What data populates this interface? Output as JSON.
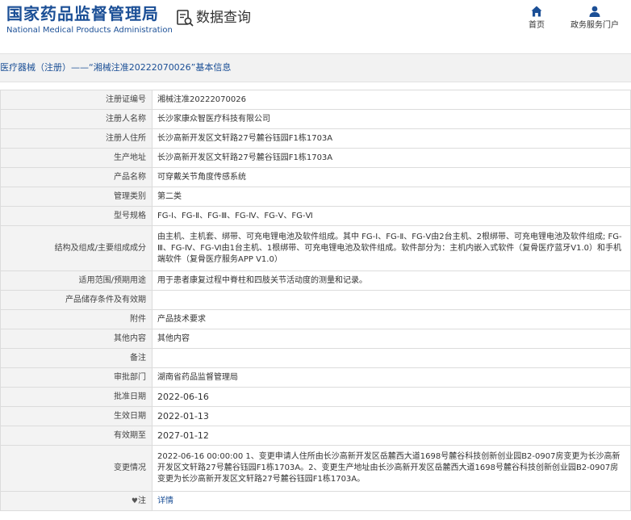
{
  "header": {
    "logo_cn": "国家药品监督管理局",
    "logo_en": "National Medical Products Administration",
    "query_label": "数据查询",
    "nav": [
      {
        "label": "首页",
        "icon": "home-icon"
      },
      {
        "label": "政务服务门户",
        "icon": "user-icon"
      }
    ]
  },
  "breadcrumb": "医疗器械（注册）——“湘械注准20222070026”基本信息",
  "colors": {
    "brand": "#1b4f96",
    "label_bg": "#f3f3f3",
    "bar_bg": "#f2f2f2"
  },
  "rows": [
    {
      "label": "注册证编号",
      "value": "湘械注准20222070026"
    },
    {
      "label": "注册人名称",
      "value": "长沙家康众智医疗科技有限公司"
    },
    {
      "label": "注册人住所",
      "value": "长沙高新开发区文轩路27号麓谷钰园F1栋1703A"
    },
    {
      "label": "生产地址",
      "value": "长沙高新开发区文轩路27号麓谷钰园F1栋1703A"
    },
    {
      "label": "产品名称",
      "value": "可穿戴关节角度传感系统"
    },
    {
      "label": "管理类别",
      "value": "第二类"
    },
    {
      "label": "型号规格",
      "value": "FG-Ⅰ、FG-Ⅱ、FG-Ⅲ、FG-Ⅳ、FG-Ⅴ、FG-Ⅵ"
    },
    {
      "label": "结构及组成/主要组成成分",
      "value": "由主机、主机套、绑带、可充电锂电池及软件组成。其中 FG-Ⅰ、FG-Ⅱ、FG-Ⅴ由2台主机、2根绑带、可充电锂电池及软件组成; FG-Ⅲ、FG-Ⅳ、FG-Ⅵ由1台主机、1根绑带、可充电锂电池及软件组成。软件部分为：主机内嵌入式软件（复骨医疗蓝牙V1.0）和手机端软件（复骨医疗服务APP V1.0）"
    },
    {
      "label": "适用范围/预期用途",
      "value": "用于患者康复过程中脊柱和四肢关节活动度的测量和记录。"
    },
    {
      "label": "产品储存条件及有效期",
      "value": ""
    },
    {
      "label": "附件",
      "value": "产品技术要求"
    },
    {
      "label": "其他内容",
      "value": "其他内容"
    },
    {
      "label": "备注",
      "value": ""
    },
    {
      "label": "审批部门",
      "value": "湖南省药品监督管理局"
    },
    {
      "label": "批准日期",
      "value": "2022-06-16"
    },
    {
      "label": "生效日期",
      "value": "2022-01-13"
    },
    {
      "label": "有效期至",
      "value": "2027-01-12"
    },
    {
      "label": "变更情况",
      "value": "2022-06-16 00:00:00 1、变更申请人住所由长沙高新开发区岳麓西大道1698号麓谷科技创新创业园B2-0907房变更为长沙高新开发区文轩路27号麓谷钰园F1栋1703A。2、变更生产地址由长沙高新开发区岳麓西大道1698号麓谷科技创新创业园B2-0907房变更为长沙高新开发区文轩路27号麓谷钰园F1栋1703A。"
    },
    {
      "label": "注",
      "value": "详情",
      "icon": "pin-icon"
    }
  ]
}
